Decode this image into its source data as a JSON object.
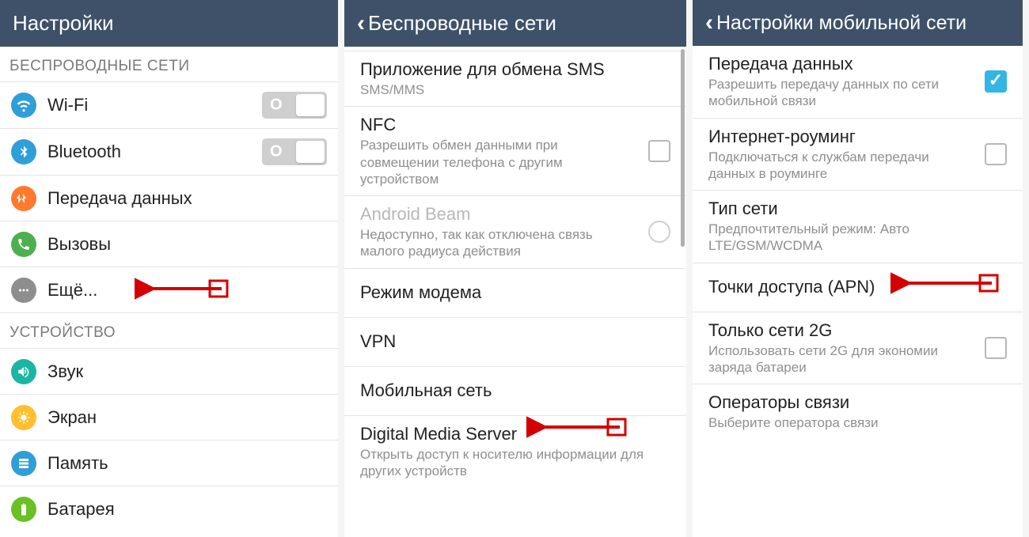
{
  "screen1": {
    "title": "Настройки",
    "sectionWireless": "БЕСПРОВОДНЫЕ СЕТИ",
    "sectionDevice": "УСТРОЙСТВО",
    "items": {
      "wifi": "Wi-Fi",
      "bluetooth": "Bluetooth",
      "data": "Передача данных",
      "calls": "Вызовы",
      "more": "Ещё...",
      "sound": "Звук",
      "screen": "Экран",
      "memory": "Память",
      "battery": "Батарея"
    }
  },
  "screen2": {
    "title": "Беспроводные сети",
    "sms": {
      "t": "Приложение для обмена SMS",
      "s": "SMS/MMS"
    },
    "nfc": {
      "t": "NFC",
      "s": "Разрешить обмен данными при совмещении телефона с другим устройством"
    },
    "beam": {
      "t": "Android Beam",
      "s": "Недоступно, так как отключена связь малого радиуса действия"
    },
    "modem": {
      "t": "Режим модема"
    },
    "vpn": {
      "t": "VPN"
    },
    "mobile": {
      "t": "Мобильная сеть"
    },
    "dms": {
      "t": "Digital Media Server",
      "s": "Открыть доступ к носителю информации для других устройств"
    }
  },
  "screen3": {
    "title": "Настройки мобильной сети",
    "data": {
      "t": "Передача данных",
      "s": "Разрешить передачу данных по сети мобильной связи"
    },
    "roaming": {
      "t": "Интернет-роуминг",
      "s": "Подключаться к службам передачи данных в роуминге"
    },
    "nettype": {
      "t": "Тип сети",
      "s": "Предпочтительный режим: Авто LTE/GSM/WCDMA"
    },
    "apn": {
      "t": "Точки доступа (APN)"
    },
    "only2g": {
      "t": "Только сети 2G",
      "s": "Использовать сети 2G для экономии заряда батареи"
    },
    "operators": {
      "t": "Операторы связи",
      "s": "Выберите оператора связи"
    }
  }
}
